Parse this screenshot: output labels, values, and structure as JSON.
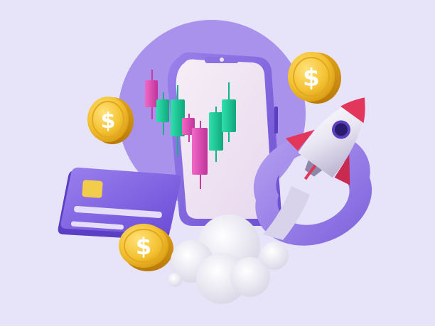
{
  "scene": {
    "background": "#e7e3f8",
    "accent_purple": "#8a6ee0",
    "coin_gold": "#f3c53a",
    "candle_green": "#1fcf9c",
    "candle_pink": "#e24fb6",
    "rocket_red": "#e2365b",
    "coin_symbol": "$"
  },
  "objects": [
    {
      "name": "phone-with-candlestick-chart",
      "icon": "smartphone-icon"
    },
    {
      "name": "credit-card",
      "icon": "credit-card-icon"
    },
    {
      "name": "rocket",
      "icon": "rocket-icon"
    },
    {
      "name": "coins",
      "icon": "dollar-coin-icon",
      "count": 3
    },
    {
      "name": "smoke-cloud",
      "icon": "cloud-icon"
    },
    {
      "name": "donut-ring",
      "icon": "ring-icon"
    }
  ]
}
